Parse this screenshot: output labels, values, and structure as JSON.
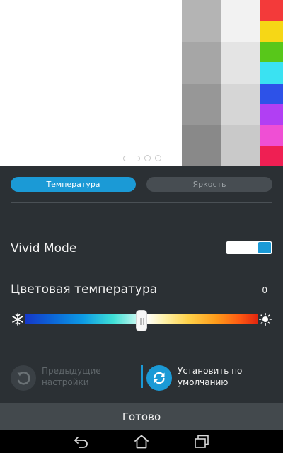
{
  "preview": {
    "gray_col_1": [
      "#b4b4b4",
      "#a6a6a6",
      "#979797",
      "#898989"
    ],
    "gray_col_2": [
      "#f2f2f2",
      "#e4e4e4",
      "#d6d6d6",
      "#c9c9c9"
    ],
    "color_col": [
      "#f33a3a",
      "#f6d716",
      "#58c71a",
      "#3ae2f2",
      "#2d52e8",
      "#b13ff3",
      "#ef4fd4",
      "#ef1f53"
    ],
    "page_dots": {
      "count": 3,
      "active": 0
    }
  },
  "tabs": [
    {
      "label": "Температура",
      "active": true
    },
    {
      "label": "Яркость",
      "active": false
    }
  ],
  "vivid_mode": {
    "label": "Vivid Mode",
    "enabled": true
  },
  "color_temperature": {
    "label": "Цветовая температура",
    "value": "0",
    "position": 0.5
  },
  "actions": {
    "previous_settings": "Предыдущие настройки",
    "reset_default": "Установить по умолчанию"
  },
  "done_label": "Готово",
  "colors": {
    "accent": "#1b9ad6",
    "panel": "#2b3034",
    "done_bar": "#43494d"
  },
  "icons": [
    "snowflake-icon",
    "sun-icon",
    "undo-icon",
    "sync-icon",
    "back-icon",
    "home-icon",
    "recent-apps-icon"
  ]
}
